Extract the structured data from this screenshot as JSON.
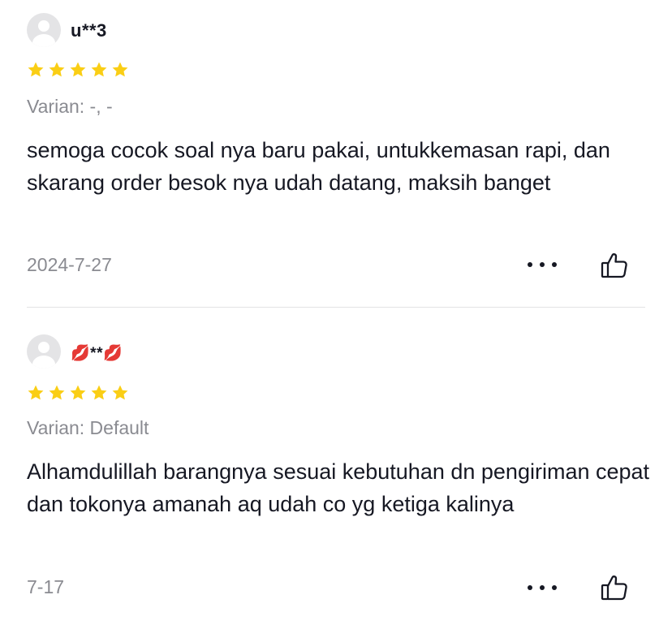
{
  "reviews": [
    {
      "username": "u**3",
      "rating": 5,
      "variant": "Varian: -, -",
      "content": "semoga cocok soal nya baru pakai, untukkemasan rapi, dan skarang order besok nya udah datang, maksih banget",
      "date": "2024-7-27"
    },
    {
      "username_emoji_left": "💋",
      "username_core": "**",
      "username_emoji_right": "💋",
      "rating": 5,
      "variant": "Varian: Default",
      "content": "Alhamdulillah barangnya sesuai kebutuhan dn pengiriman cepat dan tokonya amanah aq udah co yg ketiga kalinya",
      "date": "7-17"
    }
  ],
  "icons": {
    "star": "star-icon",
    "more": "more-horizontal-icon",
    "like": "thumbs-up-icon",
    "avatar": "default-avatar-icon"
  },
  "colors": {
    "star": "#FACE15",
    "text": "#161823",
    "muted": "#8A8B91",
    "divider": "#E3E3E5",
    "avatar_bg": "#E4E4E6"
  }
}
